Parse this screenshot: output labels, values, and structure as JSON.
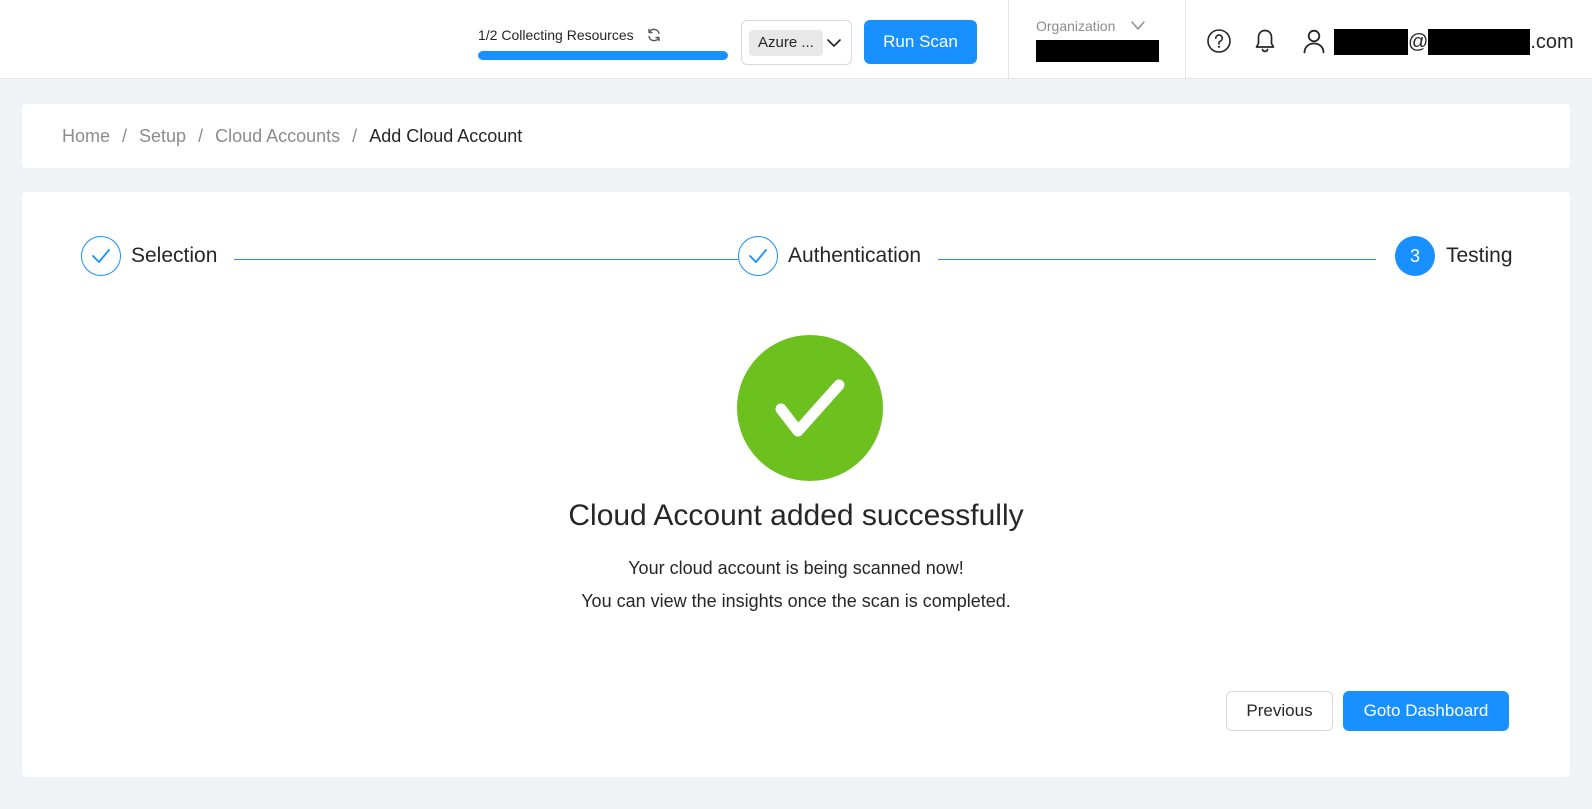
{
  "header": {
    "progress": {
      "text": "1/2 Collecting Resources",
      "value": 1.0
    },
    "cloud_selector": {
      "value": "Azure ..."
    },
    "run_scan_label": "Run Scan",
    "organization": {
      "label": "Organization"
    },
    "user": {
      "email_at": "@",
      "email_suffix": ".com"
    }
  },
  "breadcrumb": [
    {
      "label": "Home"
    },
    {
      "label": "Setup"
    },
    {
      "label": "Cloud Accounts"
    },
    {
      "label": "Add Cloud Account"
    }
  ],
  "breadcrumb_separator": "/",
  "steps": [
    {
      "label": "Selection",
      "status": "done"
    },
    {
      "label": "Authentication",
      "status": "done"
    },
    {
      "label": "Testing",
      "status": "active",
      "number": "3"
    }
  ],
  "result": {
    "title": "Cloud Account added successfully",
    "line1": "Your cloud account is being scanned now!",
    "line2": "You can view the insights once the scan is completed."
  },
  "actions": {
    "previous_label": "Previous",
    "dashboard_label": "Goto Dashboard"
  },
  "colors": {
    "primary": "#1890ff",
    "success": "#6cc11f",
    "background": "#f0f2f5"
  }
}
